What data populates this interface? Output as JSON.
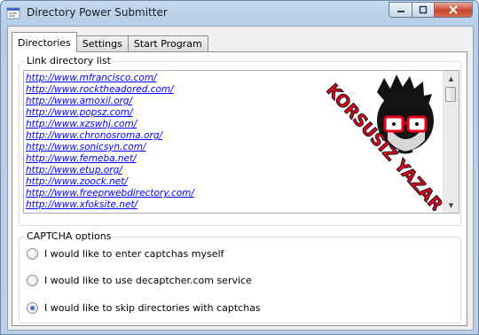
{
  "window": {
    "title": "Directory Power Submitter"
  },
  "tabs": [
    {
      "label": "Directories",
      "active": true
    },
    {
      "label": "Settings",
      "active": false
    },
    {
      "label": "Start Program",
      "active": false
    }
  ],
  "link_list": {
    "label": "Link directory list",
    "items": [
      "http://www.mfrancisco.com/",
      "http://www.rocktheadored.com/",
      "http://www.amoxil.org/",
      "http://www.popsz.com/",
      "http://www.xzswhj.com/",
      "http://www.chronosroma.org/",
      "http://www.sonicsyn.com/",
      "http://www.femeba.net/",
      "http://www.etup.org/",
      "http://www.zoock.net/",
      "http://www.freeprwebdirectory.com/",
      "http://www.xfoksite.net/"
    ],
    "overlay_text": "KORSUSIZ YAZAR"
  },
  "captcha": {
    "label": "CAPTCHA options",
    "options": [
      {
        "label": "I would like to enter captchas myself",
        "checked": false
      },
      {
        "label": "I would like to use decaptcher.com service",
        "checked": false
      },
      {
        "label": "I would like to skip directories with captchas",
        "checked": true
      }
    ]
  },
  "colors": {
    "link": "#0000ff",
    "accent": "#e8001c",
    "close_button": "#c9452f"
  },
  "icons": {
    "minimize": "minimize-icon",
    "maximize": "maximize-icon",
    "close": "close-icon"
  }
}
